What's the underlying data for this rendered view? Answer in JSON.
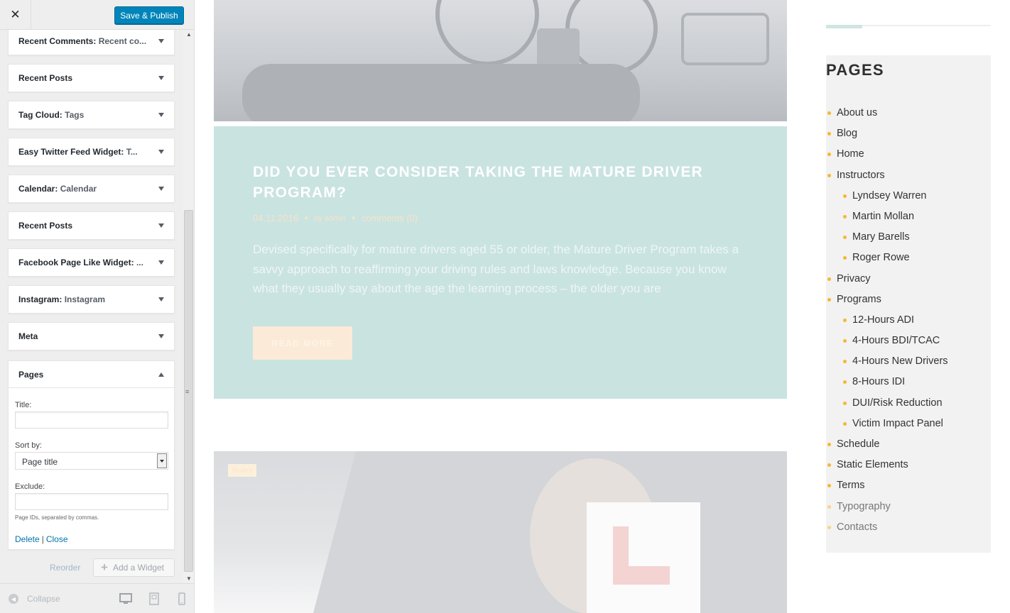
{
  "customizer": {
    "close_label": "✕",
    "save_label": "Save & Publish",
    "widgets": [
      {
        "name": "Recent Comments",
        "sub": "Recent co..."
      },
      {
        "name": "Recent Posts",
        "sub": ""
      },
      {
        "name": "Tag Cloud",
        "sub": "Tags"
      },
      {
        "name": "Easy Twitter Feed Widget",
        "sub": "T..."
      },
      {
        "name": "Calendar",
        "sub": "Calendar"
      },
      {
        "name": "Recent Posts",
        "sub": ""
      },
      {
        "name": "Facebook Page Like Widget",
        "sub": "..."
      },
      {
        "name": "Instagram",
        "sub": "Instagram"
      },
      {
        "name": "Meta",
        "sub": ""
      }
    ],
    "open_widget": {
      "name": "Pages",
      "title_label": "Title:",
      "title_value": "",
      "sort_label": "Sort by:",
      "sort_value": "Page title",
      "exclude_label": "Exclude:",
      "exclude_value": "",
      "hint": "Page IDs, separated by commas.",
      "delete_label": "Delete",
      "separator": "|",
      "close_label": "Close"
    },
    "reorder_label": "Reorder",
    "add_widget_label": "Add a Widget",
    "collapse_label": "Collapse"
  },
  "preview": {
    "post": {
      "title": "DID YOU EVER CONSIDER TAKING THE MATURE DRIVER PROGRAM?",
      "date": "04.11.2016",
      "author": "by admin",
      "comments": "comments (0)",
      "excerpt": "Devised specifically for mature drivers aged 55 or older, the Mature Driver Program takes a savvy approach to reaffirming your driving rules and laws knowledge. Because you know what they usually say about the age the learning process – the older you are",
      "read_more": "READ MORE"
    },
    "second_post": {
      "category": "Rules"
    },
    "sidebar": {
      "heading": "PAGES",
      "items": [
        {
          "label": "About us",
          "level": 0
        },
        {
          "label": "Blog",
          "level": 0
        },
        {
          "label": "Home",
          "level": 0
        },
        {
          "label": "Instructors",
          "level": 0
        },
        {
          "label": "Lyndsey Warren",
          "level": 1
        },
        {
          "label": "Martin Mollan",
          "level": 1
        },
        {
          "label": "Mary Barells",
          "level": 1
        },
        {
          "label": "Roger Rowe",
          "level": 1
        },
        {
          "label": "Privacy",
          "level": 0
        },
        {
          "label": "Programs",
          "level": 0
        },
        {
          "label": "12-Hours ADI",
          "level": 1
        },
        {
          "label": "4-Hours BDI/TCAC",
          "level": 1
        },
        {
          "label": "4-Hours New Drivers",
          "level": 1
        },
        {
          "label": "8-Hours IDI",
          "level": 1
        },
        {
          "label": "DUI/Risk Reduction",
          "level": 1
        },
        {
          "label": "Victim Impact Panel",
          "level": 1
        },
        {
          "label": "Schedule",
          "level": 0
        },
        {
          "label": "Static Elements",
          "level": 0
        },
        {
          "label": "Terms",
          "level": 0
        },
        {
          "label": "Typography",
          "level": 0
        },
        {
          "label": "Contacts",
          "level": 0
        }
      ]
    }
  },
  "colors": {
    "wp_blue": "#0085ba",
    "post_card_bg": "#c9e3e1",
    "bullet": "#f7b731",
    "read_more_bg": "#fbead7"
  }
}
